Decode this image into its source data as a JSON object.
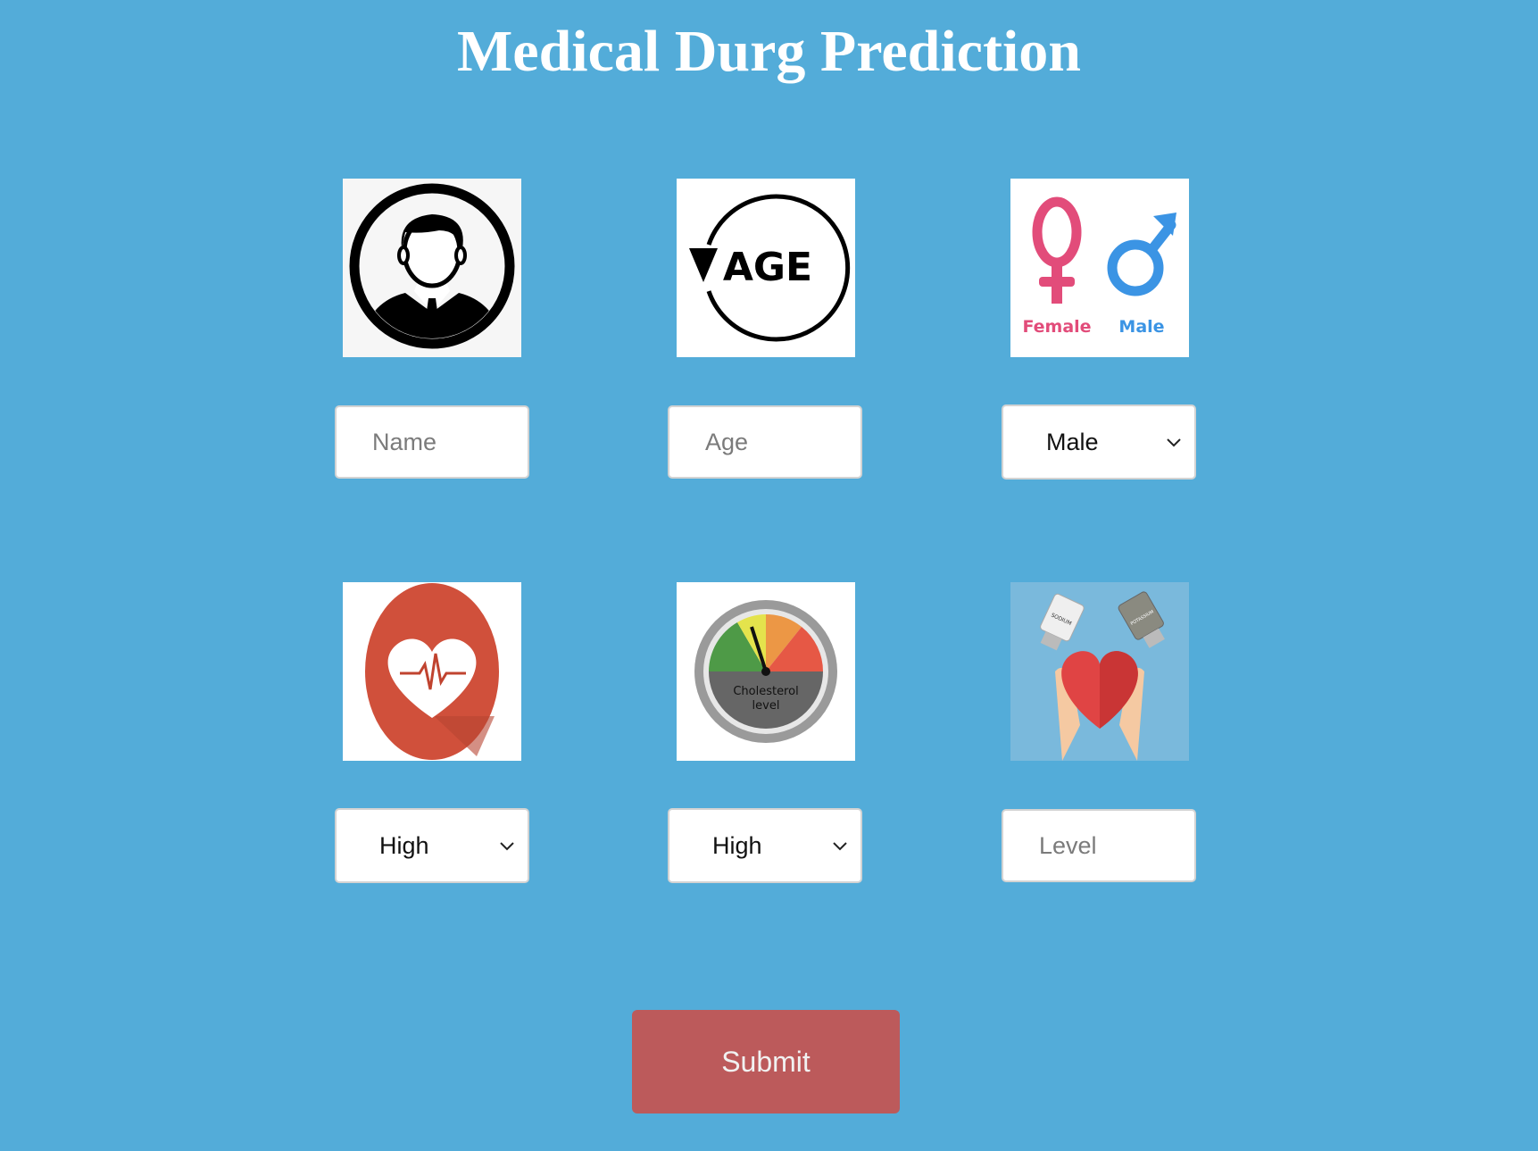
{
  "page": {
    "title": "Medical Durg Prediction",
    "background_color": "#53acd9"
  },
  "row1": {
    "name_image": {
      "icon": "person-avatar-icon"
    },
    "age_image": {
      "icon": "age-cycle-icon",
      "text": "AGE"
    },
    "sex_image": {
      "icon": "gender-symbols-icon",
      "female_label": "Female",
      "male_label": "Male"
    },
    "name_input": {
      "placeholder": "Name",
      "value": ""
    },
    "age_input": {
      "placeholder": "Age",
      "value": ""
    },
    "sex_select": {
      "selected": "Male"
    }
  },
  "row2": {
    "bp_image": {
      "icon": "heart-pulse-icon"
    },
    "cholesterol_image": {
      "icon": "cholesterol-gauge-icon",
      "text_line1": "Cholesterol",
      "text_line2": "level"
    },
    "na_k_image": {
      "icon": "sodium-potassium-heart-icon",
      "sodium_label": "SODIUM",
      "potassium_label": "POTASSIUM"
    },
    "bp_select": {
      "selected": "High"
    },
    "cholesterol_select": {
      "selected": "High"
    },
    "level_input": {
      "placeholder": "Level",
      "value": ""
    }
  },
  "submit": {
    "label": "Submit",
    "color": "#bc5a5b"
  }
}
